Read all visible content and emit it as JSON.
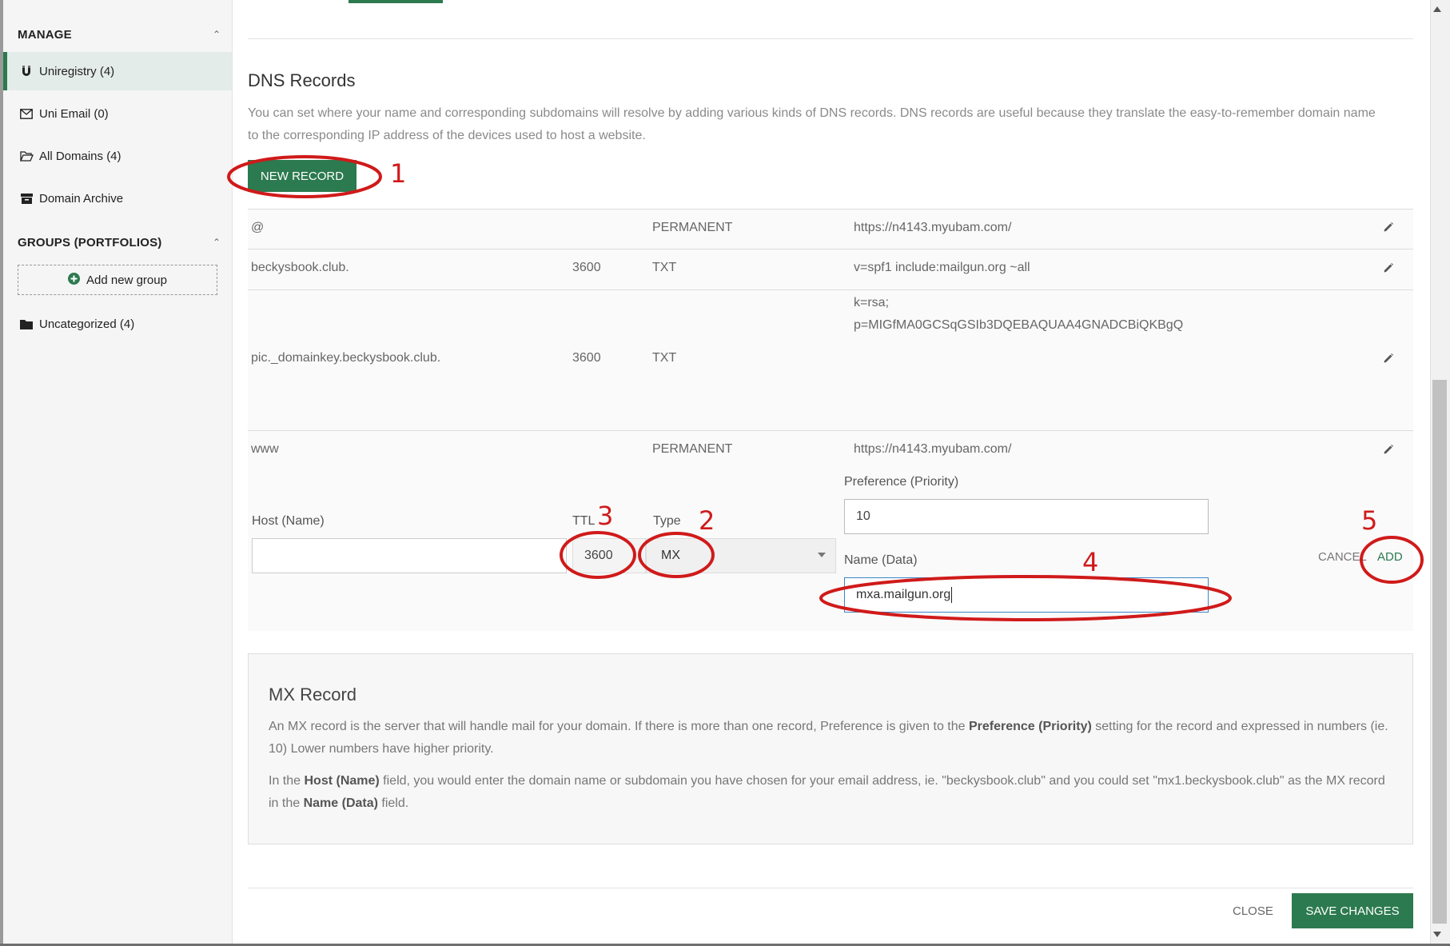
{
  "sidebar": {
    "manage_heading": "MANAGE",
    "manage_items": [
      {
        "label": "Uniregistry (4)",
        "icon": "magnet-icon"
      },
      {
        "label": "Uni Email (0)",
        "icon": "envelope-icon"
      },
      {
        "label": "All Domains (4)",
        "icon": "folder-open-icon"
      },
      {
        "label": "Domain Archive",
        "icon": "archive-icon"
      }
    ],
    "groups_heading": "GROUPS (PORTFOLIOS)",
    "add_group_label": "Add new group",
    "group_items": [
      {
        "label": "Uncategorized (4)",
        "icon": "folder-icon"
      }
    ]
  },
  "dns": {
    "title": "DNS Records",
    "description": "You can set where your name and corresponding subdomains will resolve by adding various kinds of DNS records. DNS records are useful because they translate the easy-to-remember domain name to the corresponding IP address of the devices used to host a website.",
    "new_record_label": "NEW RECORD",
    "records": [
      {
        "host": "@",
        "ttl": "",
        "type": "PERMANENT",
        "value_lines": [
          "https://n4143.myubam.com/"
        ]
      },
      {
        "host": "beckysbook.club.",
        "ttl": "3600",
        "type": "TXT",
        "value_lines": [
          "v=spf1 include:mailgun.org ~all"
        ]
      },
      {
        "host": "pic._domainkey.beckysbook.club.",
        "ttl": "3600",
        "type": "TXT",
        "value_lines": [
          "k=rsa;",
          "p=MIGfMA0GCSqGSIb3DQEBAQUAA4GNADCBiQKBgQ"
        ]
      },
      {
        "host": "www",
        "ttl": "",
        "type": "PERMANENT",
        "value_lines": [
          "https://n4143.myubam.com/"
        ]
      }
    ]
  },
  "form": {
    "host_label": "Host (Name)",
    "host_value": "",
    "ttl_label": "TTL",
    "ttl_value": "3600",
    "type_label": "Type",
    "type_value": "MX",
    "pref_label": "Preference (Priority)",
    "pref_value": "10",
    "name_label": "Name (Data)",
    "name_value": "mxa.mailgun.org",
    "cancel_label": "CANCEL",
    "add_label": "ADD"
  },
  "info": {
    "title": "MX Record",
    "p1_a": "An MX record is the server that will handle mail for your domain. If there is more than one record, Preference is given to the ",
    "p1_b": "Preference (Priority)",
    "p1_c": " setting for the record and expressed in numbers (ie. 10) Lower numbers have higher priority.",
    "p2_a": "In the ",
    "p2_b": "Host (Name)",
    "p2_c": " field, you would enter the domain name or subdomain you have chosen for your email address, ie. \"beckysbook.club\" and you could set \"mx1.beckysbook.club\" as the MX record in the ",
    "p2_d": "Name (Data)",
    "p2_e": " field."
  },
  "footer": {
    "close_label": "CLOSE",
    "save_label": "SAVE CHANGES"
  },
  "annotations": {
    "numbers": [
      "1",
      "2",
      "3",
      "4",
      "5"
    ],
    "color": "#d01a1a"
  },
  "colors": {
    "accent": "#2c7a4f",
    "annotation": "#d01a1a"
  }
}
